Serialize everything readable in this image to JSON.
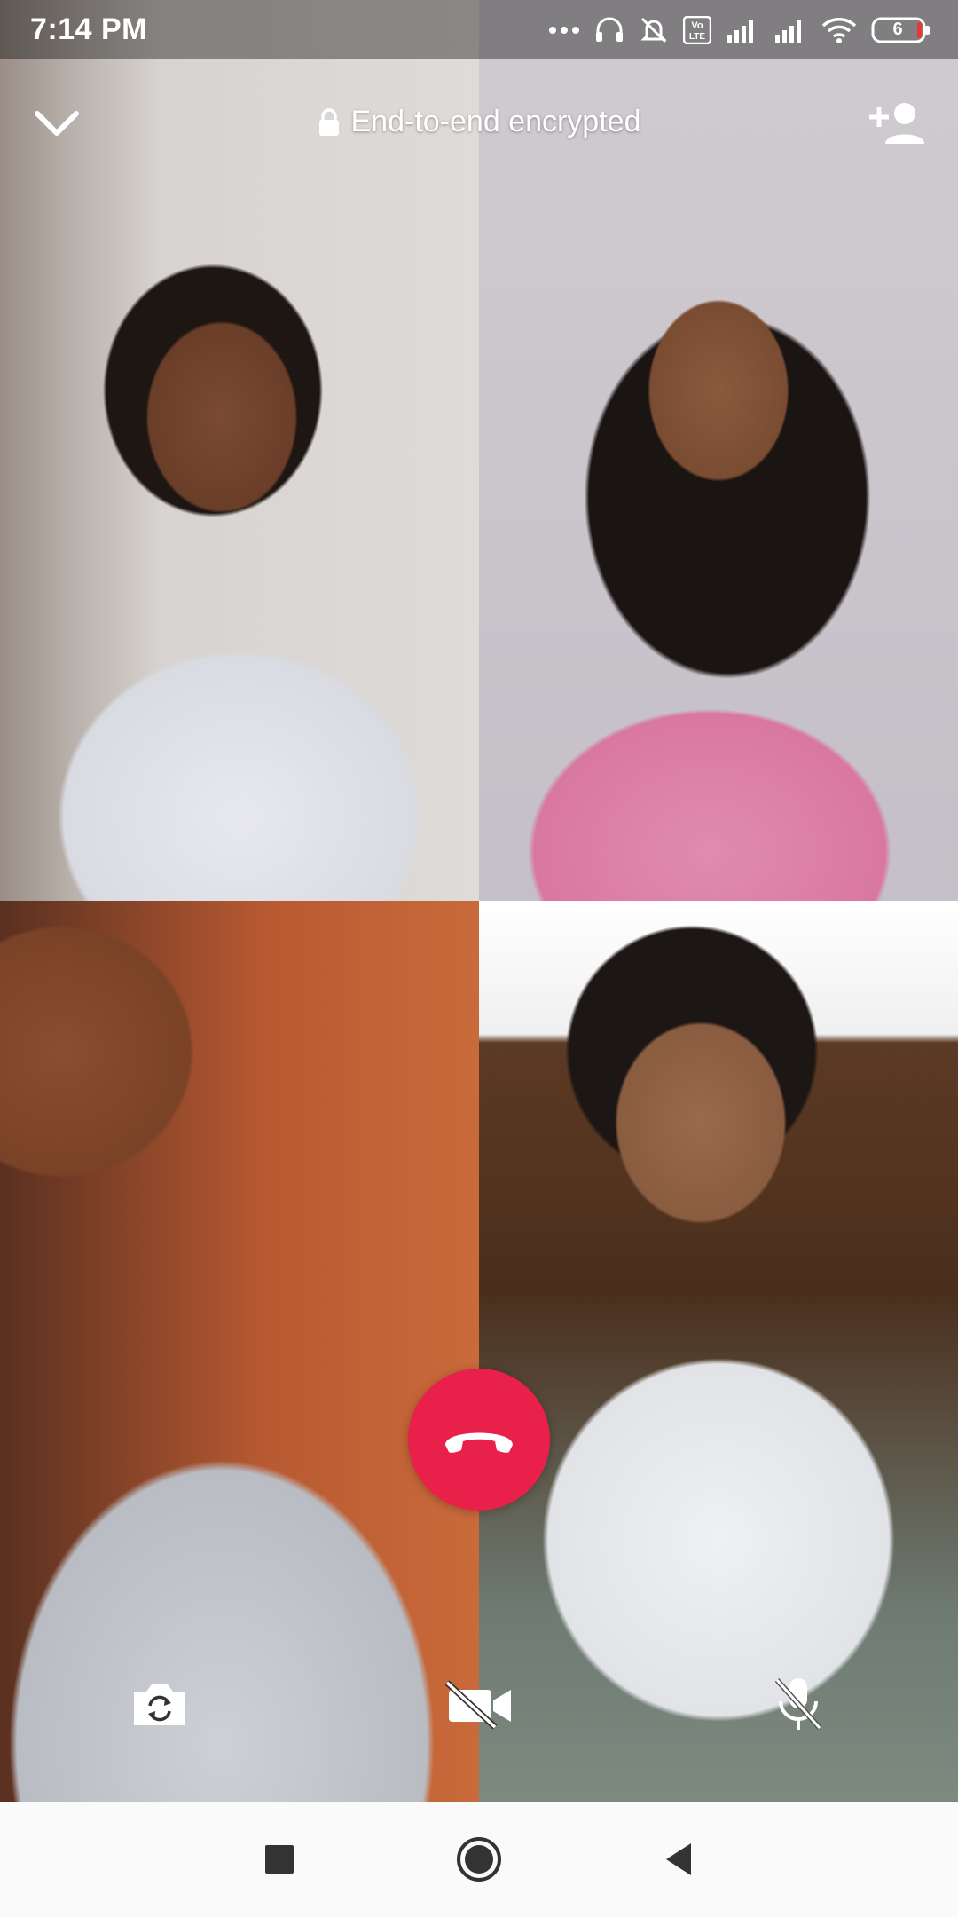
{
  "status_bar": {
    "time": "7:14 PM",
    "battery": "6",
    "icons": [
      "more-dots-icon",
      "headset-icon",
      "muted-bell-icon",
      "volte-icon",
      "signal-icon",
      "signal-icon",
      "wifi-icon",
      "battery-icon"
    ],
    "volte_label": "Vo\nLTE"
  },
  "call_header": {
    "encryption_text": "End-to-end encrypted",
    "collapse_icon": "chevron-down-icon",
    "lock_icon": "lock-icon",
    "add_icon": "add-person-icon"
  },
  "participants": [
    {
      "tile": 1,
      "description_icon": "video-feed"
    },
    {
      "tile": 2,
      "description_icon": "video-feed"
    },
    {
      "tile": 3,
      "description_icon": "video-feed"
    },
    {
      "tile": 4,
      "description_icon": "video-feed"
    }
  ],
  "controls": {
    "end_call_icon": "phone-hangup-icon",
    "end_call_color": "#e8204a",
    "flip_camera_icon": "camera-flip-icon",
    "video_off_icon": "video-off-icon",
    "mute_icon": "mic-off-icon"
  },
  "nav_bar": {
    "recents_icon": "square-icon",
    "home_icon": "circle-icon",
    "back_icon": "triangle-back-icon"
  }
}
